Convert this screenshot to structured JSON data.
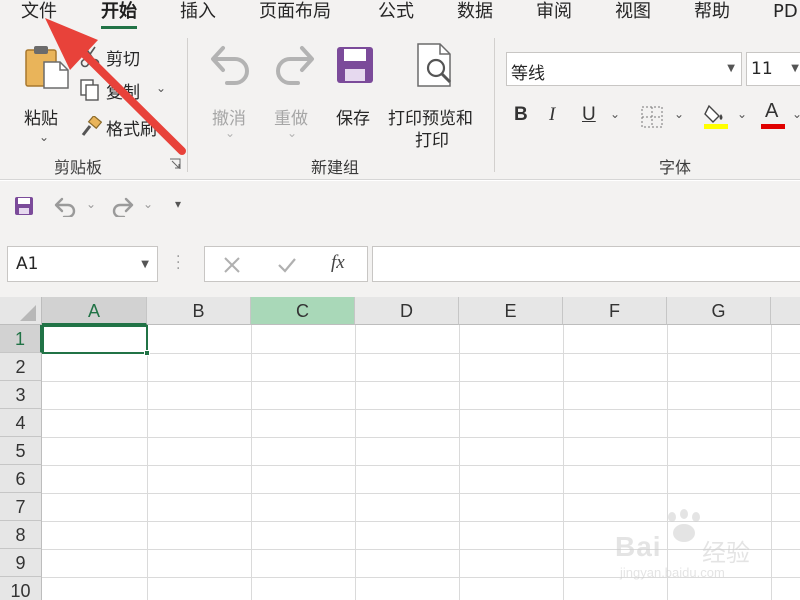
{
  "menu": {
    "tabs": [
      "文件",
      "开始",
      "插入",
      "页面布局",
      "公式",
      "数据",
      "审阅",
      "视图",
      "帮助",
      "PD"
    ],
    "active_index": 1
  },
  "ribbon": {
    "clipboard": {
      "paste": "粘贴",
      "cut": "剪切",
      "copy": "复制",
      "format_painter": "格式刷",
      "group_label": "剪贴板"
    },
    "new_group": {
      "undo": "撤消",
      "redo": "重做",
      "save": "保存",
      "print_preview_line1": "打印预览和",
      "print_preview_line2": "打印",
      "group_label": "新建组"
    },
    "font": {
      "font_name": "等线",
      "font_size": "11",
      "bold": "B",
      "italic": "I",
      "underline": "U",
      "font_color_letter": "A",
      "group_label": "字体"
    }
  },
  "formula_bar": {
    "name_box": "A1",
    "fx": "fx",
    "formula": ""
  },
  "grid": {
    "columns": [
      "A",
      "B",
      "C",
      "D",
      "E",
      "F",
      "G"
    ],
    "rows": [
      "1",
      "2",
      "3",
      "4",
      "5",
      "6",
      "7",
      "8",
      "9",
      "10"
    ],
    "selected_cell": "A1"
  },
  "watermark": {
    "main": "Bai",
    "cn": "经验",
    "sub": "jingyan.baidu.com"
  },
  "colors": {
    "accent": "#217346",
    "highlight_column": "#a9d8b8",
    "annotation_arrow": "#e8423a",
    "fill_color_bar": "#ffff00",
    "font_color_bar": "#e00000",
    "save_icon": "#7b4b9a"
  }
}
